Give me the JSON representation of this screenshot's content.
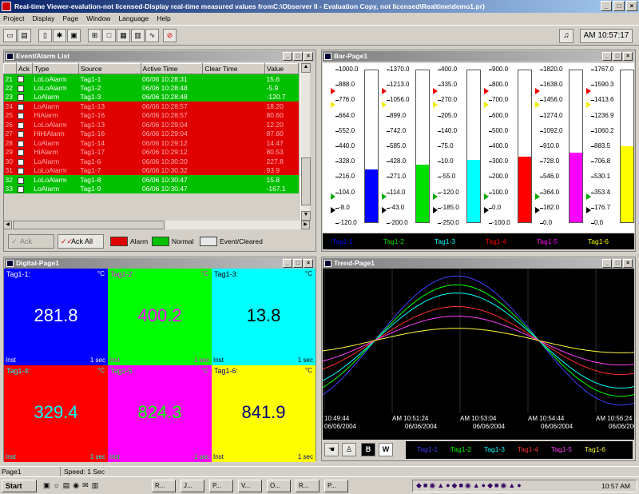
{
  "window": {
    "title": "Real-time Viewer-evalution-not licensed-Display real-time measured values fromC:\\Observer II - Evaluation Copy, not licensed\\Realtime\\demo1.pr}"
  },
  "menu": [
    "Project",
    "Display",
    "Page",
    "Window",
    "Language",
    "Help"
  ],
  "toolbar": {
    "clock": "AM 10:57:17"
  },
  "event_panel": {
    "title": "Event/Alarm List",
    "columns": [
      "",
      "Ack",
      "Type",
      "Source",
      "Active Time",
      "Clear Time",
      "Value"
    ],
    "rows": [
      {
        "id": "21",
        "type": "LoLoAlarm",
        "source": "Tag1-1",
        "active": "06/06 10:28:31",
        "clear": "",
        "value": "15.6",
        "state": "normal"
      },
      {
        "id": "22",
        "type": "LoLoAlarm",
        "source": "Tag1-2",
        "active": "06/06 10:28:48",
        "clear": "",
        "value": "-5.9",
        "state": "normal"
      },
      {
        "id": "23",
        "type": "LoAlarm",
        "source": "Tag1-3",
        "active": "06/06 10:28:48",
        "clear": "",
        "value": "-120.7",
        "state": "normal"
      },
      {
        "id": "24",
        "type": "LoAlarm",
        "source": "Tag1-13",
        "active": "06/06 10:28:57",
        "clear": "",
        "value": "18.20",
        "state": "alarm"
      },
      {
        "id": "25",
        "type": "HiAlarm",
        "source": "Tag1-16",
        "active": "06/06 10:28:57",
        "clear": "",
        "value": "80.60",
        "state": "alarm"
      },
      {
        "id": "26",
        "type": "LoLoAlarm",
        "source": "Tag1-13",
        "active": "06/06 10:29:04",
        "clear": "",
        "value": "12.20",
        "state": "alarm"
      },
      {
        "id": "27",
        "type": "HiHiAlarm",
        "source": "Tag1-16",
        "active": "06/06 10:29:04",
        "clear": "",
        "value": "87.60",
        "state": "alarm"
      },
      {
        "id": "28",
        "type": "LoAlarm",
        "source": "Tag1-14",
        "active": "06/06 10:29:12",
        "clear": "",
        "value": "14.47",
        "state": "alarm"
      },
      {
        "id": "29",
        "type": "HiAlarm",
        "source": "Tag1-17",
        "active": "06/06 10:29:12",
        "clear": "",
        "value": "80.53",
        "state": "alarm"
      },
      {
        "id": "30",
        "type": "LoAlarm",
        "source": "Tag1-6",
        "active": "06/06 10:30:20",
        "clear": "",
        "value": "227.8",
        "state": "alarm"
      },
      {
        "id": "31",
        "type": "LoLoAlarm",
        "source": "Tag1-7",
        "active": "06/06 10:30:32",
        "clear": "",
        "value": "93.9",
        "state": "alarm"
      },
      {
        "id": "32",
        "type": "LoLoAlarm",
        "source": "Tag1-8",
        "active": "06/06 10:30:47",
        "clear": "",
        "value": "15.8",
        "state": "normal"
      },
      {
        "id": "33",
        "type": "LoAlarm",
        "source": "Tag1-9",
        "active": "06/06 10:30:47",
        "clear": "",
        "value": "-167.1",
        "state": "normal"
      }
    ],
    "footer": {
      "ack": "Ack",
      "ack_all": "Ack All",
      "alarm": "Alarm",
      "normal": "Normal",
      "event": "Event/Cleared"
    },
    "colors": {
      "alarm": "#e00000",
      "normal": "#00c000"
    }
  },
  "bar_panel": {
    "title": "Bar-Page1",
    "bars": [
      {
        "tag": "Tag1-1",
        "color": "#0000ff",
        "level": 0.35,
        "ticks": [
          "1000.0",
          "888.0",
          "776.0",
          "664.0",
          "552.0",
          "440.0",
          "328.0",
          "216.0",
          "104.0",
          "-8.0",
          "-120.0"
        ]
      },
      {
        "tag": "Tag1-2",
        "color": "#00e000",
        "level": 0.38,
        "ticks": [
          "1370.0",
          "1213.0",
          "1056.0",
          "899.0",
          "742.0",
          "585.0",
          "428.0",
          "271.0",
          "114.0",
          "-43.0",
          "-200.0"
        ]
      },
      {
        "tag": "Tag1-3",
        "color": "#00ffff",
        "level": 0.41,
        "ticks": [
          "400.0",
          "335.0",
          "270.0",
          "205.0",
          "140.0",
          "75.0",
          "10.0",
          "-55.0",
          "-120.0",
          "-185.0",
          "-250.0"
        ]
      },
      {
        "tag": "Tag1-4",
        "color": "#ff0000",
        "level": 0.43,
        "ticks": [
          "900.0",
          "800.0",
          "700.0",
          "600.0",
          "500.0",
          "400.0",
          "300.0",
          "200.0",
          "100.0",
          "0.0",
          "-100.0"
        ]
      },
      {
        "tag": "Tag1-5",
        "color": "#ff00ff",
        "level": 0.46,
        "ticks": [
          "1820.0",
          "1638.0",
          "1456.0",
          "1274.0",
          "1092.0",
          "910.0",
          "728.0",
          "546.0",
          "364.0",
          "182.0",
          "0.0"
        ]
      },
      {
        "tag": "Tag1-6",
        "color": "#ffff00",
        "level": 0.5,
        "ticks": [
          "1767.0",
          "1590.3",
          "1413.6",
          "1236.9",
          "1060.2",
          "883.5",
          "706.8",
          "530.1",
          "353.4",
          "176.7",
          "0.0"
        ]
      }
    ]
  },
  "digital_panel": {
    "title": "Digital-Page1",
    "tiles": [
      {
        "tag": "Tag1-1:",
        "unit": "°C",
        "value": "281.8",
        "mode": "Inst",
        "rate": "1 sec",
        "bg": "#0000ff",
        "fg": "#ffffff"
      },
      {
        "tag": "Tag1-2",
        "unit": "°C",
        "value": "400.2",
        "mode": "Inst",
        "rate": "1 sec",
        "bg": "#00ff00",
        "fg": "#ff00ff"
      },
      {
        "tag": "Tag1-3:",
        "unit": "°C",
        "value": "13.8",
        "mode": "Inst",
        "rate": "1 sec",
        "bg": "#00ffff",
        "fg": "#000000"
      },
      {
        "tag": "Tag1-4:",
        "unit": "°C",
        "value": "329.4",
        "mode": "Inst",
        "rate": "1 sec",
        "bg": "#ff0000",
        "fg": "#00ffff"
      },
      {
        "tag": "Tag1-5",
        "unit": "°C",
        "value": "824.3",
        "mode": "Inst",
        "rate": "1 sec",
        "bg": "#ff00ff",
        "fg": "#00ff00"
      },
      {
        "tag": "Tag1-6:",
        "unit": "°C",
        "value": "841.9",
        "mode": "Inst",
        "rate": "1 sec",
        "bg": "#ffff00",
        "fg": "#000080"
      }
    ]
  },
  "trend_panel": {
    "title": "Trend-Page1",
    "time_labels": [
      {
        "t": "10:49:44",
        "d": "06/06/2004"
      },
      {
        "t": "AM 10:51:24",
        "d": "06/06/2004"
      },
      {
        "t": "AM 10:53:04",
        "d": "06/06/2004"
      },
      {
        "t": "AM 10:54:44",
        "d": "06/06/2004"
      },
      {
        "t": "AM 10:56:24",
        "d": "06/06/2004"
      }
    ],
    "buttons": {
      "b": "B",
      "w": "W"
    },
    "legend": [
      {
        "tag": "Tag1-1",
        "color": "#4040ff",
        "amp": 0.95
      },
      {
        "tag": "Tag1-2",
        "color": "#00ff00",
        "amp": 0.82
      },
      {
        "tag": "Tag1-3",
        "color": "#00ffff",
        "amp": 0.7
      },
      {
        "tag": "Tag1-4",
        "color": "#ff3030",
        "amp": 0.5
      },
      {
        "tag": "Tag1-5",
        "color": "#ff40ff",
        "amp": 0.36
      },
      {
        "tag": "Tag1-6",
        "color": "#ffff40",
        "amp": 0.18
      }
    ]
  },
  "status": {
    "left": "Page1",
    "speed": "Speed: 1 Sec"
  },
  "taskbar": {
    "start": "Start",
    "tasks": [
      "R...",
      "J...",
      "P...",
      "V...",
      "O...",
      "R...",
      "P..."
    ],
    "time": "10:57 AM"
  }
}
